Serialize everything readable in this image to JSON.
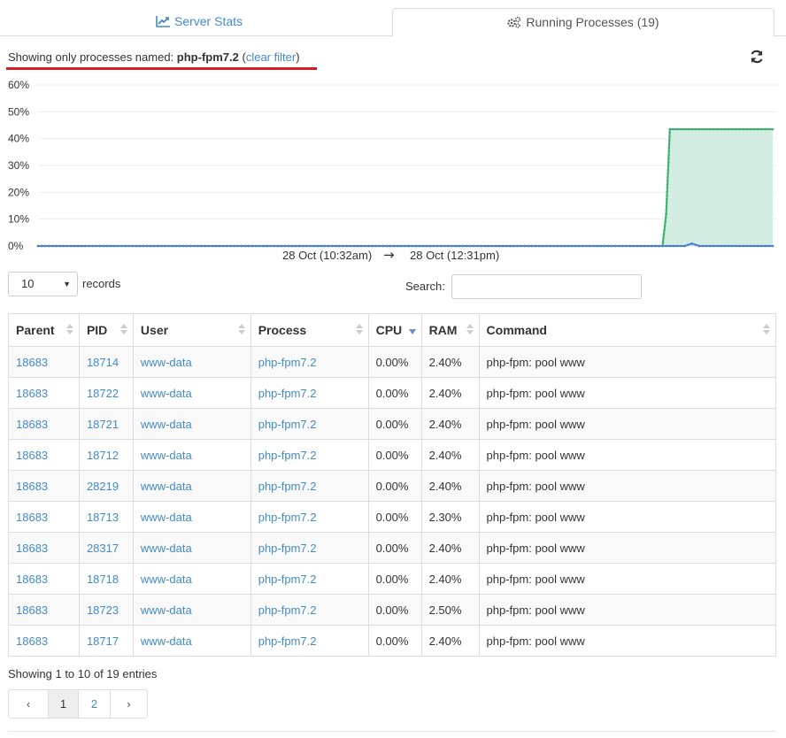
{
  "tabs": [
    {
      "label": "Server Stats",
      "icon": "line-chart-icon"
    },
    {
      "label": "Running Processes (19)",
      "icon": "cogs-icon"
    }
  ],
  "filter": {
    "prefix": "Showing only processes named:",
    "name": "php-fpm7.2",
    "open_paren": "(",
    "clear_label": "clear filter",
    "close_paren": ")"
  },
  "colors": {
    "link": "#428bca",
    "cpu_series": "#3cb371",
    "ram_series": "#4a7fd4",
    "highlight_underline": "#d71920"
  },
  "chart_data": {
    "type": "area",
    "y_ticks": [
      "0%",
      "10%",
      "20%",
      "30%",
      "40%",
      "50%",
      "60%"
    ],
    "ylim": [
      0,
      60
    ],
    "x_range_label": {
      "start": "28 Oct (10:32am)",
      "arrow": "→",
      "end": "28 Oct (12:31pm)"
    },
    "grid": true,
    "series": [
      {
        "color": "#3cb371",
        "fill": "#d4ede2",
        "points": [
          [
            0,
            0
          ],
          [
            0.85,
            0
          ],
          [
            0.855,
            12
          ],
          [
            0.86,
            43.5
          ],
          [
            1,
            43.5
          ]
        ]
      },
      {
        "color": "#4a7fd4",
        "points": [
          [
            0,
            0
          ],
          [
            0.88,
            0
          ],
          [
            0.89,
            0.9
          ],
          [
            0.9,
            0
          ],
          [
            1,
            0
          ]
        ]
      }
    ]
  },
  "controls": {
    "page_length": "10",
    "records_label": "records",
    "search_label": "Search:",
    "search_value": ""
  },
  "table": {
    "columns": [
      "Parent",
      "PID",
      "User",
      "Process",
      "CPU",
      "RAM",
      "Command"
    ],
    "sorted_column": "CPU",
    "rows": [
      [
        "18683",
        "18714",
        "www-data",
        "php-fpm7.2",
        "0.00%",
        "2.40%",
        "php-fpm: pool www"
      ],
      [
        "18683",
        "18722",
        "www-data",
        "php-fpm7.2",
        "0.00%",
        "2.40%",
        "php-fpm: pool www"
      ],
      [
        "18683",
        "18721",
        "www-data",
        "php-fpm7.2",
        "0.00%",
        "2.40%",
        "php-fpm: pool www"
      ],
      [
        "18683",
        "18712",
        "www-data",
        "php-fpm7.2",
        "0.00%",
        "2.40%",
        "php-fpm: pool www"
      ],
      [
        "18683",
        "28219",
        "www-data",
        "php-fpm7.2",
        "0.00%",
        "2.40%",
        "php-fpm: pool www"
      ],
      [
        "18683",
        "18713",
        "www-data",
        "php-fpm7.2",
        "0.00%",
        "2.30%",
        "php-fpm: pool www"
      ],
      [
        "18683",
        "28317",
        "www-data",
        "php-fpm7.2",
        "0.00%",
        "2.40%",
        "php-fpm: pool www"
      ],
      [
        "18683",
        "18718",
        "www-data",
        "php-fpm7.2",
        "0.00%",
        "2.40%",
        "php-fpm: pool www"
      ],
      [
        "18683",
        "18723",
        "www-data",
        "php-fpm7.2",
        "0.00%",
        "2.50%",
        "php-fpm: pool www"
      ],
      [
        "18683",
        "18717",
        "www-data",
        "php-fpm7.2",
        "0.00%",
        "2.40%",
        "php-fpm: pool www"
      ]
    ]
  },
  "footer": {
    "info": "Showing 1 to 10 of 19 entries",
    "pager": {
      "prev": "‹",
      "pages": [
        "1",
        "2"
      ],
      "active": "1",
      "next": "›"
    }
  }
}
